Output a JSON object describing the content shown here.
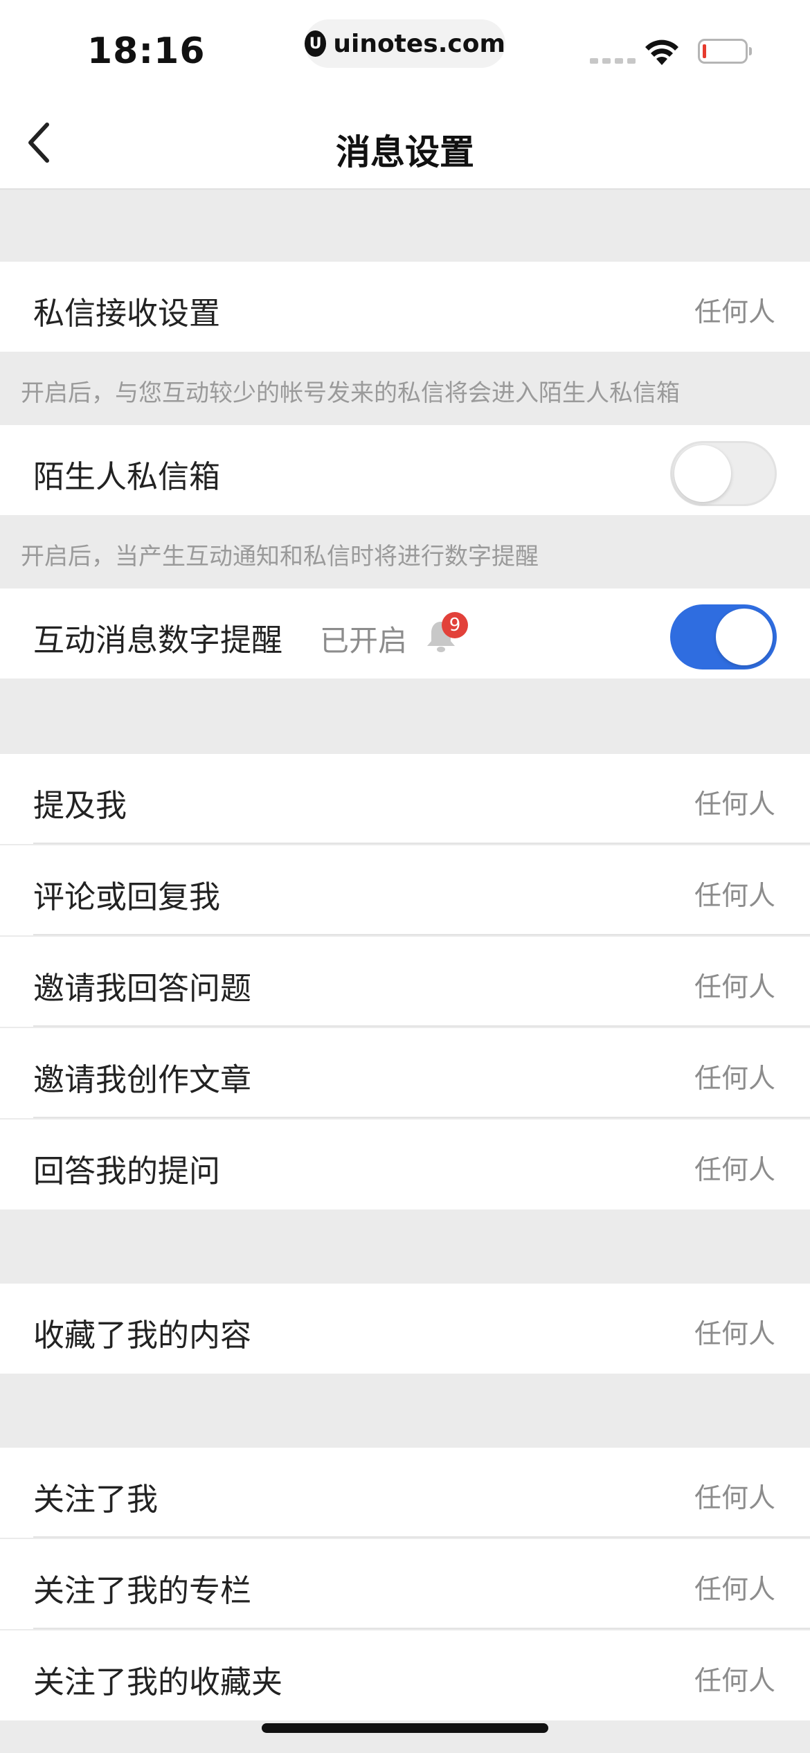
{
  "status_bar": {
    "time": "18:16",
    "url": "uinotes.com"
  },
  "nav": {
    "title": "消息设置"
  },
  "dm_settings": {
    "label": "私信接收设置",
    "value": "任何人"
  },
  "hint_stranger": "开启后，与您互动较少的帐号发来的私信将会进入陌生人私信箱",
  "stranger_inbox": {
    "label": "陌生人私信箱",
    "enabled": false
  },
  "hint_reminder": "开启后，当产生互动通知和私信时将进行数字提醒",
  "interaction_reminder": {
    "label": "互动消息数字提醒",
    "status": "已开启",
    "badge": "9",
    "enabled": true
  },
  "group1": [
    {
      "label": "提及我",
      "value": "任何人"
    },
    {
      "label": "评论或回复我",
      "value": "任何人"
    },
    {
      "label": "邀请我回答问题",
      "value": "任何人"
    },
    {
      "label": "邀请我创作文章",
      "value": "任何人"
    },
    {
      "label": "回答我的提问",
      "value": "任何人"
    }
  ],
  "group2": [
    {
      "label": "收藏了我的内容",
      "value": "任何人"
    }
  ],
  "group3": [
    {
      "label": "关注了我",
      "value": "任何人"
    },
    {
      "label": "关注了我的专栏",
      "value": "任何人"
    },
    {
      "label": "关注了我的收藏夹",
      "value": "任何人"
    }
  ],
  "colors": {
    "accent": "#2f6de0",
    "badge": "#e2413a",
    "section_bg": "#ebebeb"
  }
}
